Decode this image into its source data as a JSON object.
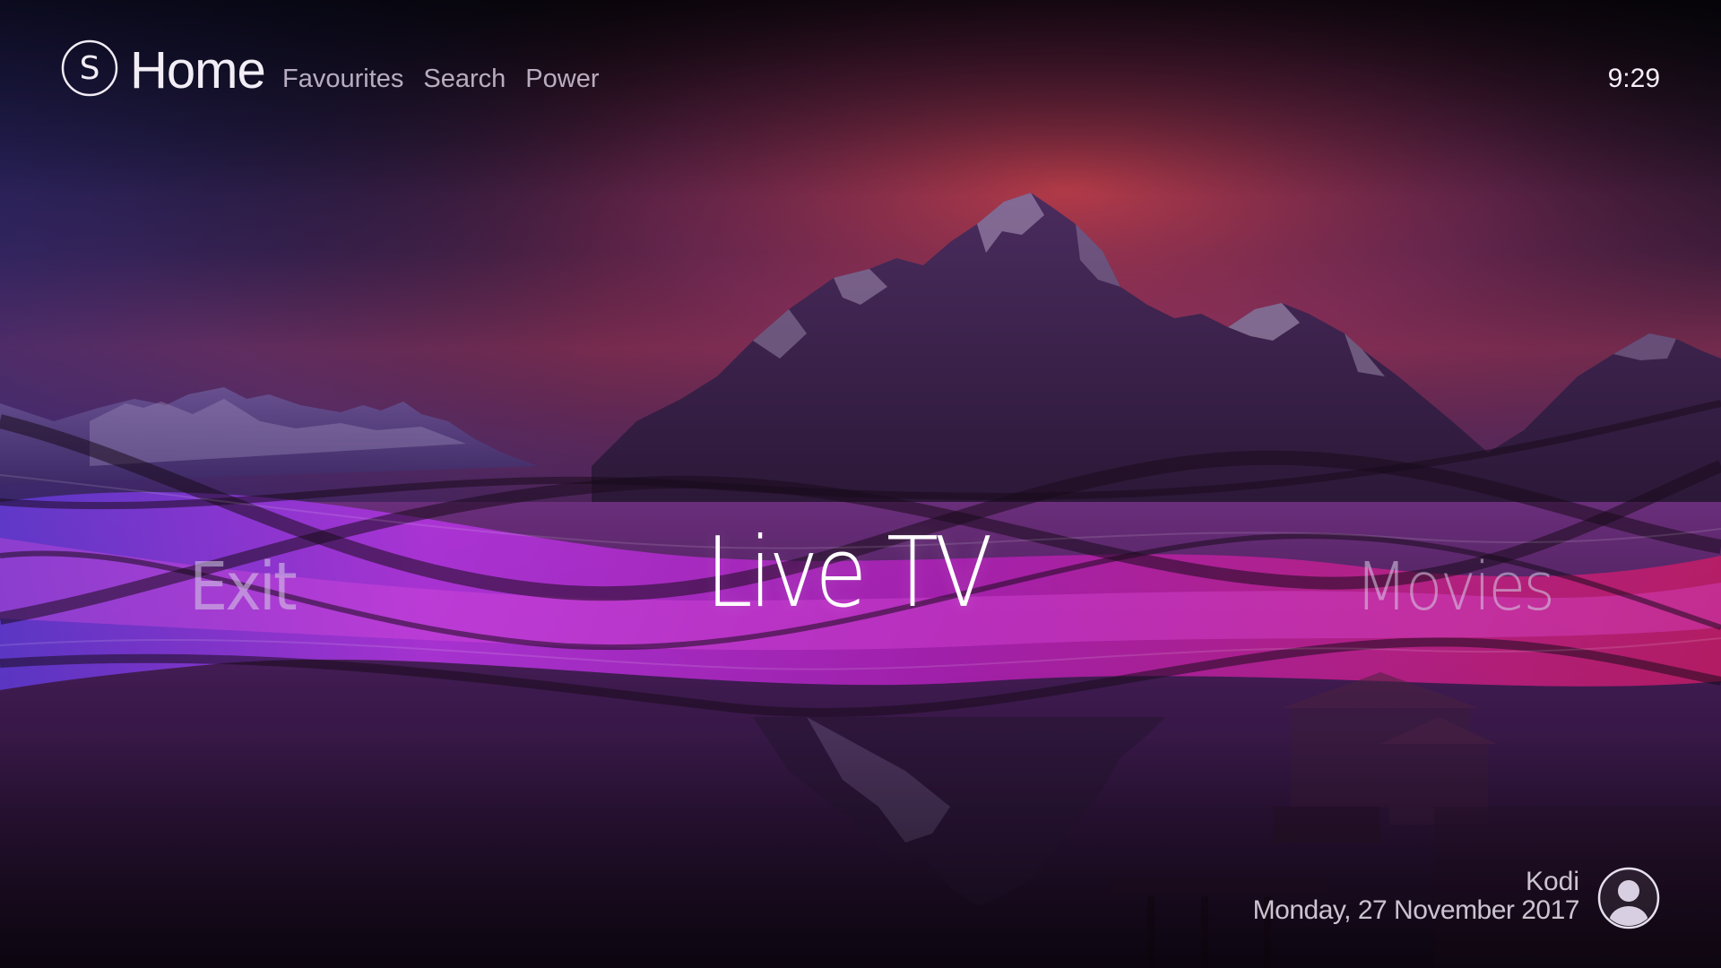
{
  "header": {
    "logo_letter": "S",
    "title": "Home",
    "nav": [
      {
        "label": "Favourites"
      },
      {
        "label": "Search"
      },
      {
        "label": "Power"
      }
    ],
    "clock": "9:29"
  },
  "main_menu": {
    "previous": "Exit",
    "current": "Live TV",
    "next": "Movies"
  },
  "profile": {
    "name": "Kodi",
    "date": "Monday, 27 November 2017",
    "avatar_icon": "user-icon"
  },
  "colors": {
    "sky_top": "#0e0a18",
    "sunset": "#d8405e",
    "ribbon_purple": "#b02ad6",
    "ribbon_magenta": "#d1248e",
    "water": "#3a1a4a"
  }
}
